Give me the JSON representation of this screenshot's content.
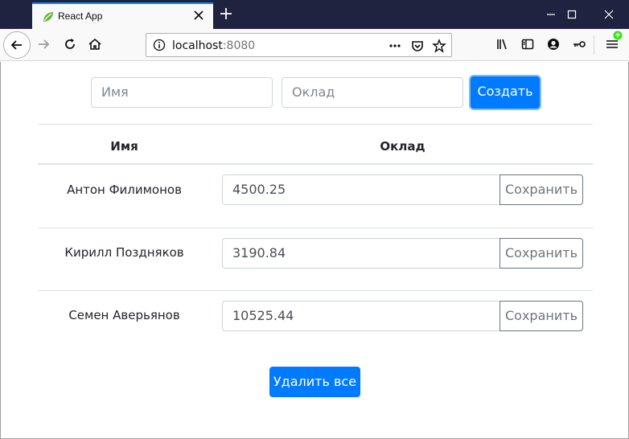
{
  "browser": {
    "tab_title": "React App",
    "url_host": "localhost",
    "url_port": ":8080"
  },
  "form": {
    "name_placeholder": "Имя",
    "salary_placeholder": "Оклад",
    "create_label": "Создать"
  },
  "table": {
    "headers": [
      "Имя",
      "Оклад"
    ],
    "rows": [
      {
        "name": "Антон Филимонов",
        "salary": "4500.25",
        "save_label": "Сохранить"
      },
      {
        "name": "Кирилл Поздняков",
        "salary": "3190.84",
        "save_label": "Сохранить"
      },
      {
        "name": "Семен Аверьянов",
        "salary": "10525.44",
        "save_label": "Сохранить"
      }
    ]
  },
  "delete_all_label": "Удалить все",
  "colors": {
    "primary": "#007bff",
    "titlebar": "#202340",
    "tab_accent": "#0a84ff"
  }
}
